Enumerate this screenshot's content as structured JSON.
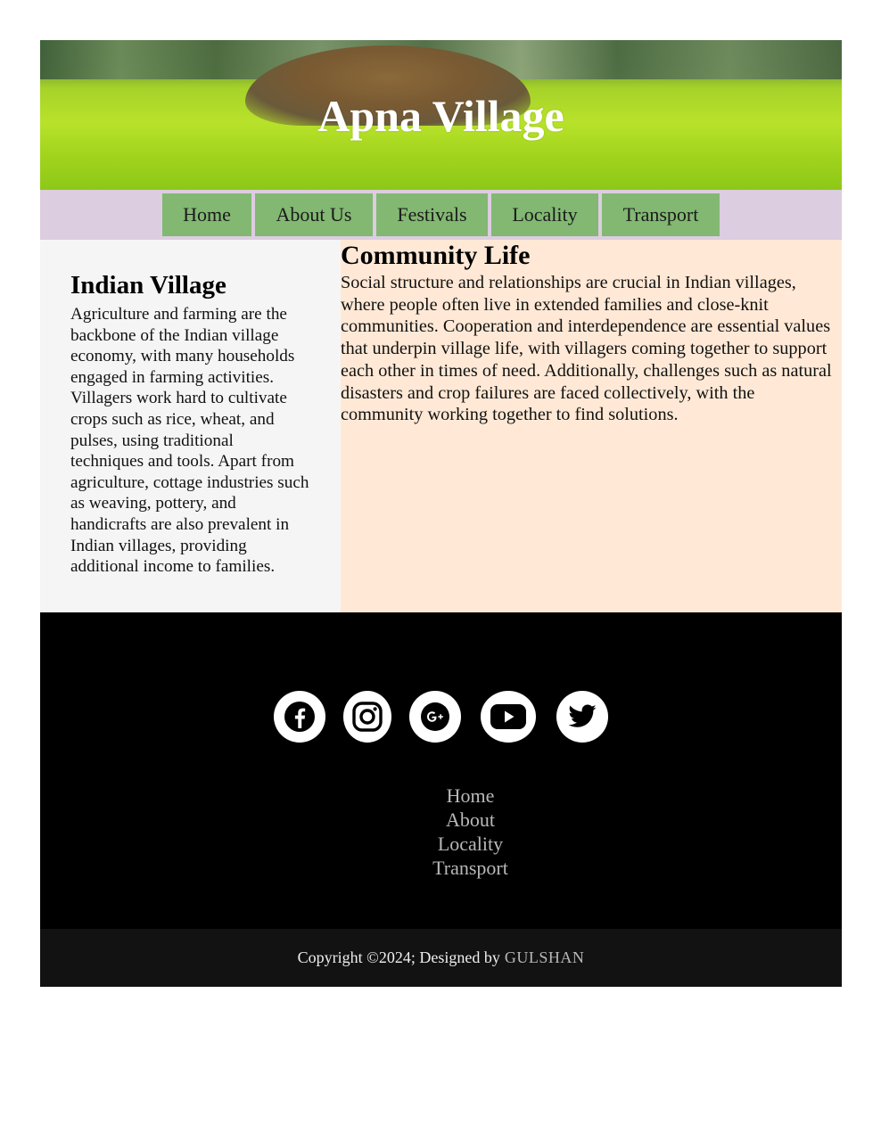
{
  "header": {
    "title": "Apna Village"
  },
  "nav": {
    "items": [
      {
        "label": "Home"
      },
      {
        "label": "About Us"
      },
      {
        "label": "Festivals"
      },
      {
        "label": "Locality"
      },
      {
        "label": "Transport"
      }
    ]
  },
  "left_section": {
    "heading": "Indian Village",
    "body": "Agriculture and farming are the backbone of the Indian village economy, with many households engaged in farming activities. Villagers work hard to cultivate crops such as rice, wheat, and pulses, using traditional techniques and tools. Apart from agriculture, cottage industries such as weaving, pottery, and handicrafts are also prevalent in Indian villages, providing additional income to families."
  },
  "right_section": {
    "heading": "Community Life",
    "body": "Social structure and relationships are crucial in Indian villages, where people often live in extended families and close-knit communities. Cooperation and interdependence are essential values that underpin village life, with villagers coming together to support each other in times of need. Additionally, challenges such as natural disasters and crop failures are faced collectively, with the community working together to find solutions."
  },
  "footer": {
    "socials": [
      {
        "icon": "facebook-icon"
      },
      {
        "icon": "instagram-icon"
      },
      {
        "icon": "google-plus-icon"
      },
      {
        "icon": "youtube-icon"
      },
      {
        "icon": "twitter-icon"
      }
    ],
    "links": [
      {
        "label": "Home"
      },
      {
        "label": "About"
      },
      {
        "label": "Locality"
      },
      {
        "label": "Transport"
      }
    ],
    "copyright_text": "Copyright ©2024; Designed by",
    "designer": "GULSHAN"
  },
  "colors": {
    "nav_bg": "#dccde0",
    "nav_item": "#82b872",
    "left_bg": "#f5f5f5",
    "right_bg": "#ffe9d6",
    "footer_bg": "#000000",
    "copyright_bg": "#121212",
    "footer_link": "#b8b8b8"
  }
}
